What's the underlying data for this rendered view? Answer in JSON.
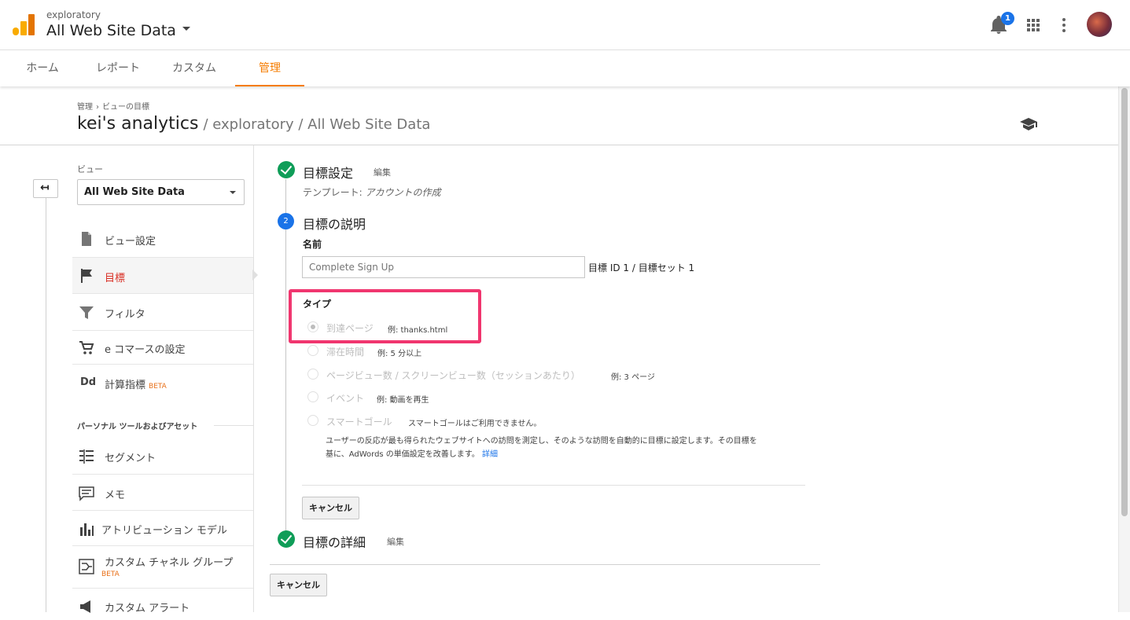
{
  "header": {
    "account_sub": "exploratory",
    "account_main": "All Web Site Data",
    "notification_count": "1"
  },
  "tabs": [
    {
      "label": "ホーム"
    },
    {
      "label": "レポート"
    },
    {
      "label": "カスタム"
    },
    {
      "label": "管理"
    }
  ],
  "page": {
    "breadcrumb": [
      "管理",
      "ビューの目標"
    ],
    "title_main": "kei's analytics",
    "title_rest": "/ exploratory / All Web Site Data"
  },
  "sidebar": {
    "view_label": "ビュー",
    "view_value": "All Web Site Data",
    "items": [
      {
        "label": "ビュー設定"
      },
      {
        "label": "目標"
      },
      {
        "label": "フィルタ"
      },
      {
        "label": "e コマースの設定"
      },
      {
        "label": "計算指標",
        "badge": "BETA"
      }
    ],
    "section_title": "パーソナル ツールおよびアセット",
    "tools": [
      {
        "label": "セグメント"
      },
      {
        "label": "メモ"
      },
      {
        "label": "アトリビューション モデル"
      },
      {
        "label": "カスタム チャネル グループ",
        "badge": "BETA"
      },
      {
        "label": "カスタム アラート"
      }
    ]
  },
  "steps": {
    "step1_title": "目標設定",
    "step1_edit": "編集",
    "template_label": "テンプレート:",
    "template_value": "アカウントの作成",
    "step2_number": "2",
    "step2_title": "目標の説明",
    "name_label": "名前",
    "name_placeholder": "Complete Sign Up",
    "goal_id": "目標 ID 1 / 目標セット 1",
    "type_label": "タイプ",
    "types": [
      {
        "label": "到達ページ",
        "example": "例: thanks.html"
      },
      {
        "label": "滞在時間",
        "example": "例: 5 分以上"
      },
      {
        "label": "ページビュー数 / スクリーンビュー数（セッションあたり）",
        "example": "例: 3 ページ"
      },
      {
        "label": "イベント",
        "example": "例: 動画を再生"
      },
      {
        "label": "スマートゴール",
        "example": "スマートゴールはご利用できません。"
      }
    ],
    "smart_desc_1": "ユーザーの反応が最も得られたウェブサイトへの訪問を測定し、そのような訪問を自動的に目標に設定します。その目標を",
    "smart_desc_2": "基に、AdWords の単価設定を改善します。",
    "smart_link": "詳細",
    "cancel_inner": "キャンセル",
    "step3_title": "目標の詳細",
    "step3_edit": "編集",
    "cancel_outer": "キャンセル"
  },
  "colors": {
    "accent": "#f57c00",
    "highlight": "#f0366f",
    "success": "#0f9d58",
    "active_item": "#d93025"
  }
}
